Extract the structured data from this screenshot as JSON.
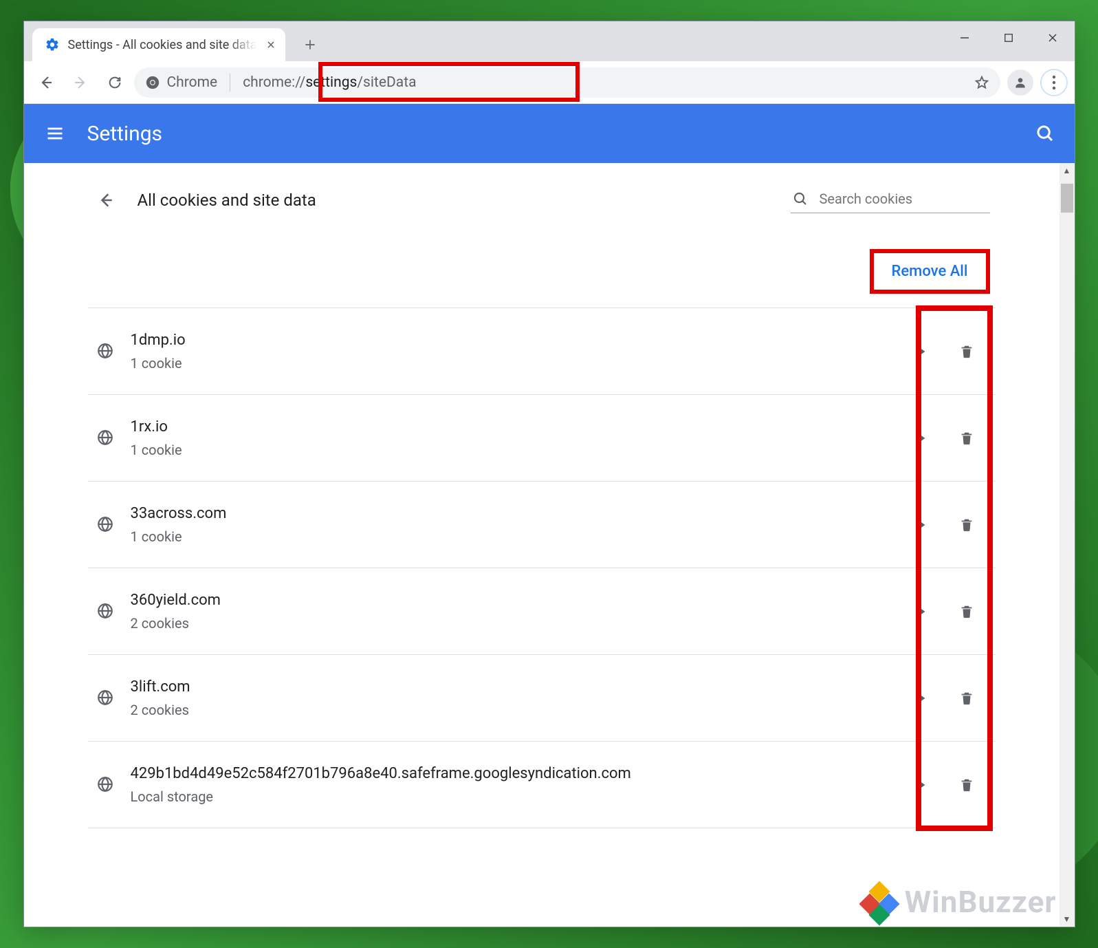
{
  "window": {
    "tab_title": "Settings - All cookies and site data",
    "new_tab_tooltip": "New tab"
  },
  "toolbar": {
    "omnibox_scheme_label": "Chrome",
    "url_prefix": "chrome://",
    "url_dark": "settings",
    "url_suffix": "/siteData"
  },
  "header": {
    "title": "Settings"
  },
  "page": {
    "title": "All cookies and site data",
    "search_placeholder": "Search cookies",
    "remove_all_label": "Remove All"
  },
  "sites": [
    {
      "domain": "1dmp.io",
      "detail": "1 cookie"
    },
    {
      "domain": "1rx.io",
      "detail": "1 cookie"
    },
    {
      "domain": "33across.com",
      "detail": "1 cookie"
    },
    {
      "domain": "360yield.com",
      "detail": "2 cookies"
    },
    {
      "domain": "3lift.com",
      "detail": "2 cookies"
    },
    {
      "domain": "429b1bd4d49e52c584f2701b796a8e40.safeframe.googlesyndication.com",
      "detail": "Local storage"
    }
  ],
  "watermark": "WinBuzzer"
}
